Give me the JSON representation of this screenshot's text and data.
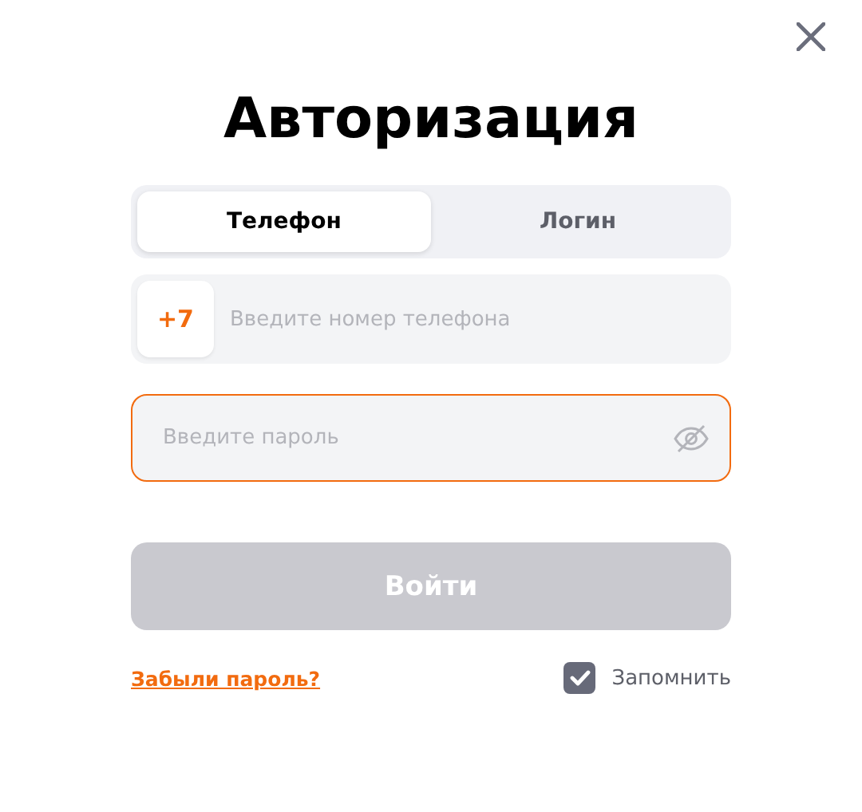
{
  "title": "Авторизация",
  "tabs": [
    {
      "label": "Телефон",
      "selected": true
    },
    {
      "label": "Логин",
      "selected": false
    }
  ],
  "phone": {
    "prefix": "+7",
    "placeholder": "Введите номер телефона"
  },
  "password": {
    "placeholder": "Введите пароль",
    "focused": true
  },
  "submit": {
    "label": "Войти",
    "disabled": true
  },
  "forgot_link": "Забыли пароль?",
  "remember": {
    "label": "Запомнить",
    "checked": true
  }
}
